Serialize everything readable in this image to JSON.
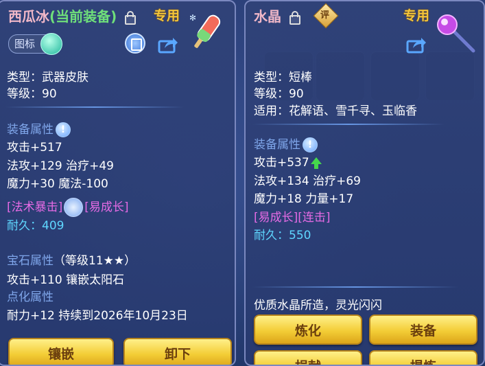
{
  "left": {
    "title_name": "西瓜冰",
    "title_status": "(当前装备)",
    "exclusive": "专用",
    "icon_toggle_label": "图标",
    "type_line": "类型：武器皮肤",
    "level_line": "等级：90",
    "equip_attr_title": "装备属性",
    "stats": [
      "攻击+517",
      "法攻+129 治疗+49",
      "魔力+30 魔法-100"
    ],
    "special_1": "[法术暴击]",
    "special_2": "[易成长]",
    "durability_label": "耐久：",
    "durability_value": "409",
    "gem_title": "宝石属性",
    "gem_level": "（等级11★★）",
    "gem_line": "攻击+110 镶嵌太阳石",
    "refine_title": "点化属性",
    "refine_line": "耐力+12 持续到2026年10月23日",
    "btn_inlay": "镶嵌",
    "btn_unequip": "卸下"
  },
  "right": {
    "title_name": "水晶",
    "eval_badge": "评",
    "exclusive": "专用",
    "type_line": "类型：短棒",
    "level_line": "等级：90",
    "fit_line": "适用：花解语、雪千寻、玉临香",
    "equip_attr_title": "装备属性",
    "stat_1": "攻击+537",
    "stats": [
      "法攻+134 治疗+69",
      "魔力+18 力量+17"
    ],
    "specials": "[易成长][连击]",
    "durability_label": "耐久：",
    "durability_value": "550",
    "description": "优质水晶所造，灵光闪闪",
    "btn_refine": "炼化",
    "btn_equip": "装备",
    "btn_donate": "捐献",
    "btn_extract": "提炼"
  },
  "colors": {
    "accent_pink": "#e66be5",
    "accent_cyan": "#5fd7ff",
    "section_blue": "#7fa6ea",
    "gold": "#f4c63a"
  }
}
